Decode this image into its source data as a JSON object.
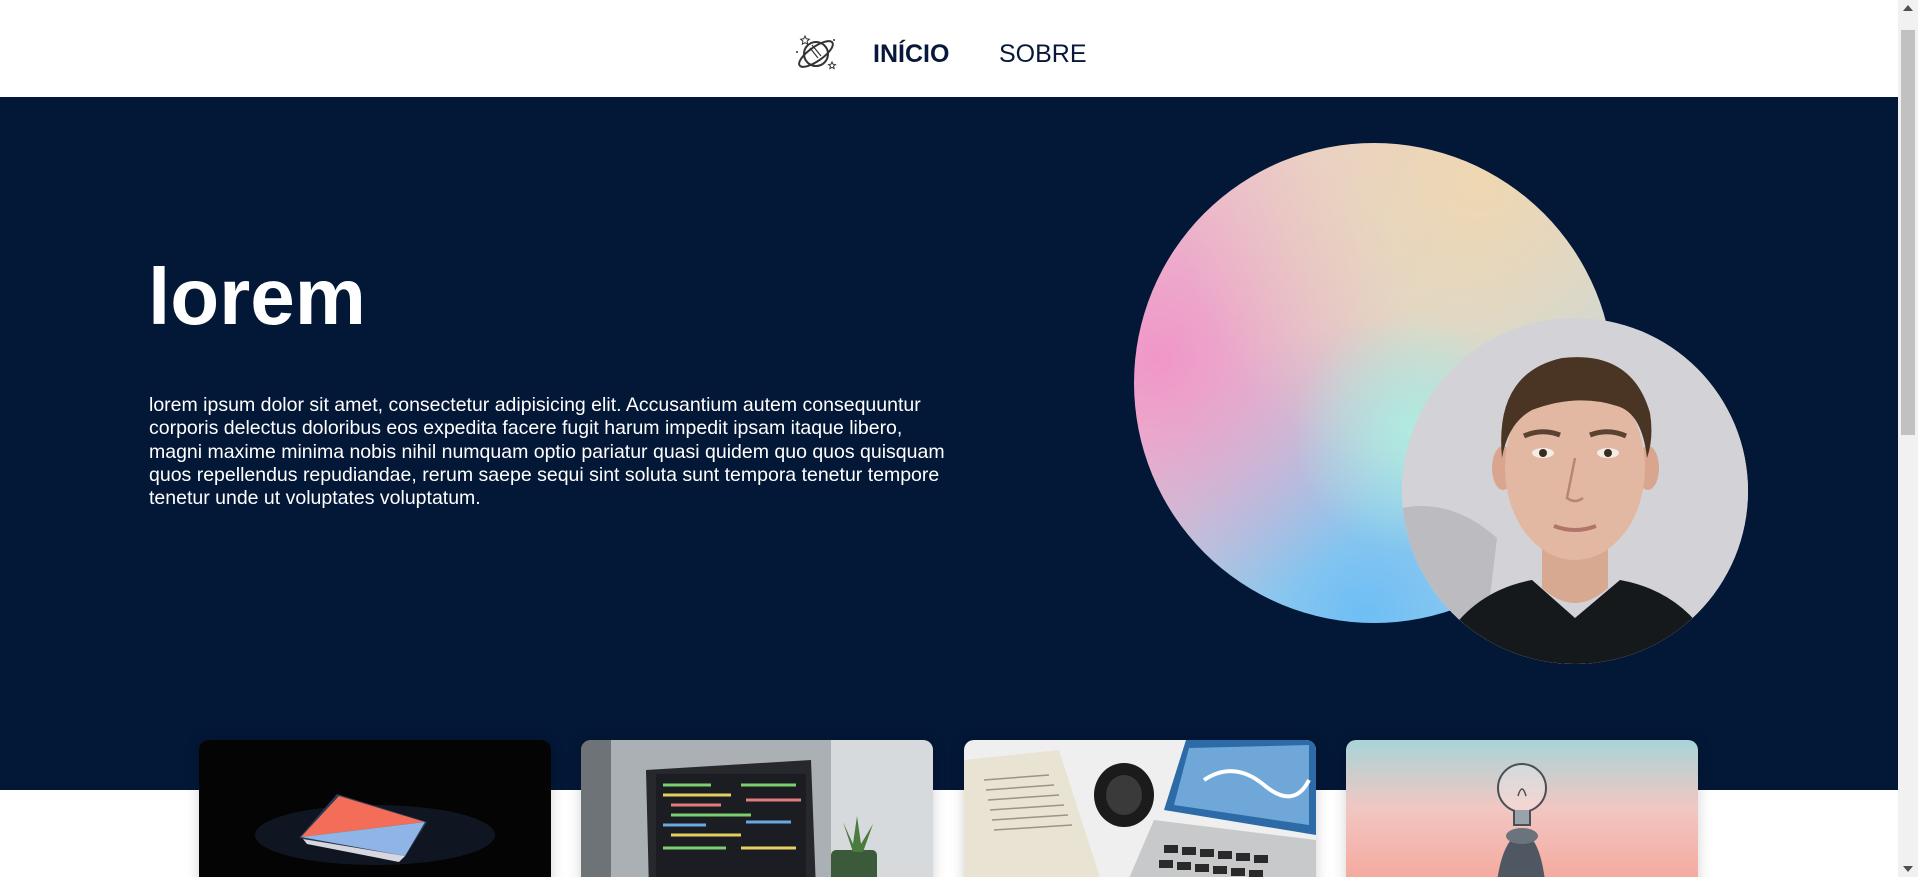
{
  "header": {
    "logo_icon": "planet-icon",
    "nav": [
      {
        "label": "INÍCIO",
        "active": true
      },
      {
        "label": "SOBRE",
        "active": false
      }
    ]
  },
  "hero": {
    "title": "lorem",
    "text": "lorem ipsum dolor sit amet, consectetur adipisicing elit. Accusantium autem consequuntur corporis delectus doloribus eos expedita facere fugit harum impedit ipsam itaque libero, magni maxime minima nobis nihil numquam optio pariatur quasi quidem quo quos quisquam quos repellendus repudiandae, rerum saepe sequi sint soluta sunt tempora tenetur tempore tenetur unde ut voluptates voluptatum.",
    "background": "#031737"
  },
  "cards": [
    {
      "image": "laptop-dark-photo"
    },
    {
      "image": "laptop-code-photo"
    },
    {
      "image": "desk-camera-photo"
    },
    {
      "image": "lightbulb-photo"
    }
  ],
  "colors": {
    "navy": "#031737",
    "nav_text": "#08183a",
    "white": "#ffffff"
  }
}
